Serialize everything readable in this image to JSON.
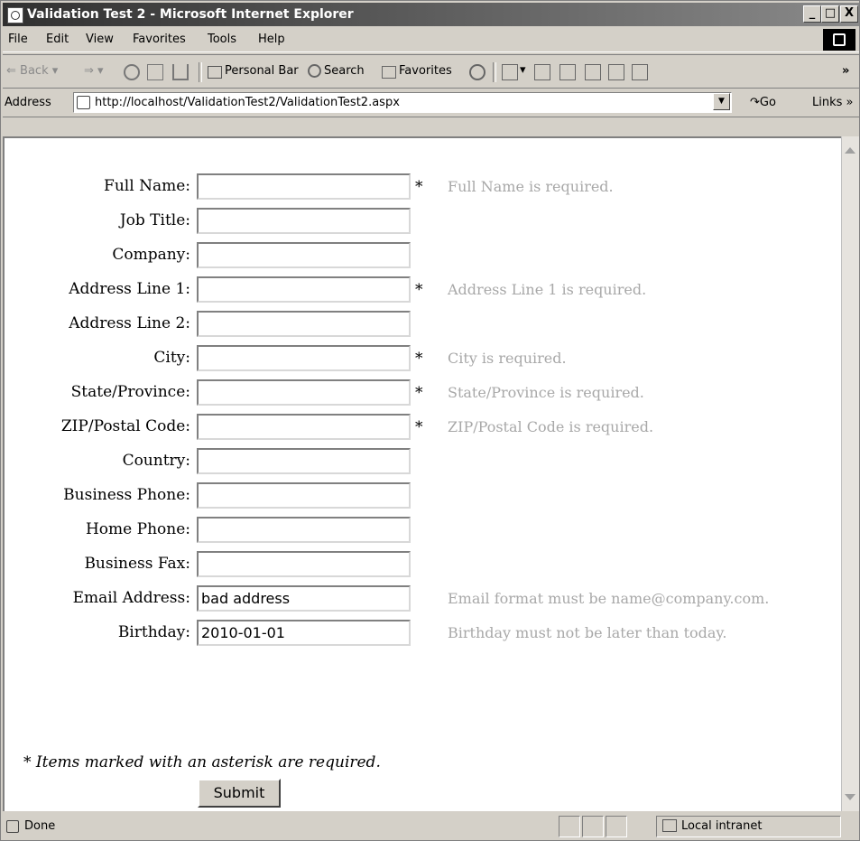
{
  "window": {
    "title": "Validation Test 2 - Microsoft Internet Explorer",
    "minimize_glyph": "_",
    "maximize_glyph": "□",
    "close_glyph": "X"
  },
  "menu": [
    "File",
    "Edit",
    "View",
    "Favorites",
    "Tools",
    "Help"
  ],
  "toolbar": {
    "back": "Back",
    "personal_bar": "Personal Bar",
    "search": "Search",
    "favorites": "Favorites",
    "overflow": "»"
  },
  "address": {
    "label": "Address",
    "url": "http://localhost/ValidationTest2/ValidationTest2.aspx",
    "go": "Go",
    "links": "Links »"
  },
  "form": {
    "rows": [
      {
        "label": "Full Name:",
        "value": "",
        "required": true,
        "error": "Full Name is required."
      },
      {
        "label": "Job Title:",
        "value": "",
        "required": false,
        "error": ""
      },
      {
        "label": "Company:",
        "value": "",
        "required": false,
        "error": ""
      },
      {
        "label": "Address Line 1:",
        "value": "",
        "required": true,
        "error": "Address Line 1 is required."
      },
      {
        "label": "Address Line 2:",
        "value": "",
        "required": false,
        "error": ""
      },
      {
        "label": "City:",
        "value": "",
        "required": true,
        "error": "City is required."
      },
      {
        "label": "State/Province:",
        "value": "",
        "required": true,
        "error": "State/Province is required."
      },
      {
        "label": "ZIP/Postal Code:",
        "value": "",
        "required": true,
        "error": "ZIP/Postal Code is required."
      },
      {
        "label": "Country:",
        "value": "",
        "required": false,
        "error": ""
      },
      {
        "label": "Business Phone:",
        "value": "",
        "required": false,
        "error": ""
      },
      {
        "label": "Home Phone:",
        "value": "",
        "required": false,
        "error": ""
      },
      {
        "label": "Business Fax:",
        "value": "",
        "required": false,
        "error": ""
      },
      {
        "label": "Email Address:",
        "value": "bad address",
        "required": false,
        "error": "Email format must be name@company.com."
      },
      {
        "label": "Birthday:",
        "value": "2010-01-01",
        "required": false,
        "error": "Birthday must not be later than today."
      }
    ],
    "asterisk": "*",
    "required_note": "* Items marked with an asterisk are required.",
    "submit_label": "Submit"
  },
  "status": {
    "text": "Done",
    "zone": "Local intranet"
  },
  "colors": {
    "error_text": "#a8a8a8",
    "chrome": "#d4d0c8"
  }
}
